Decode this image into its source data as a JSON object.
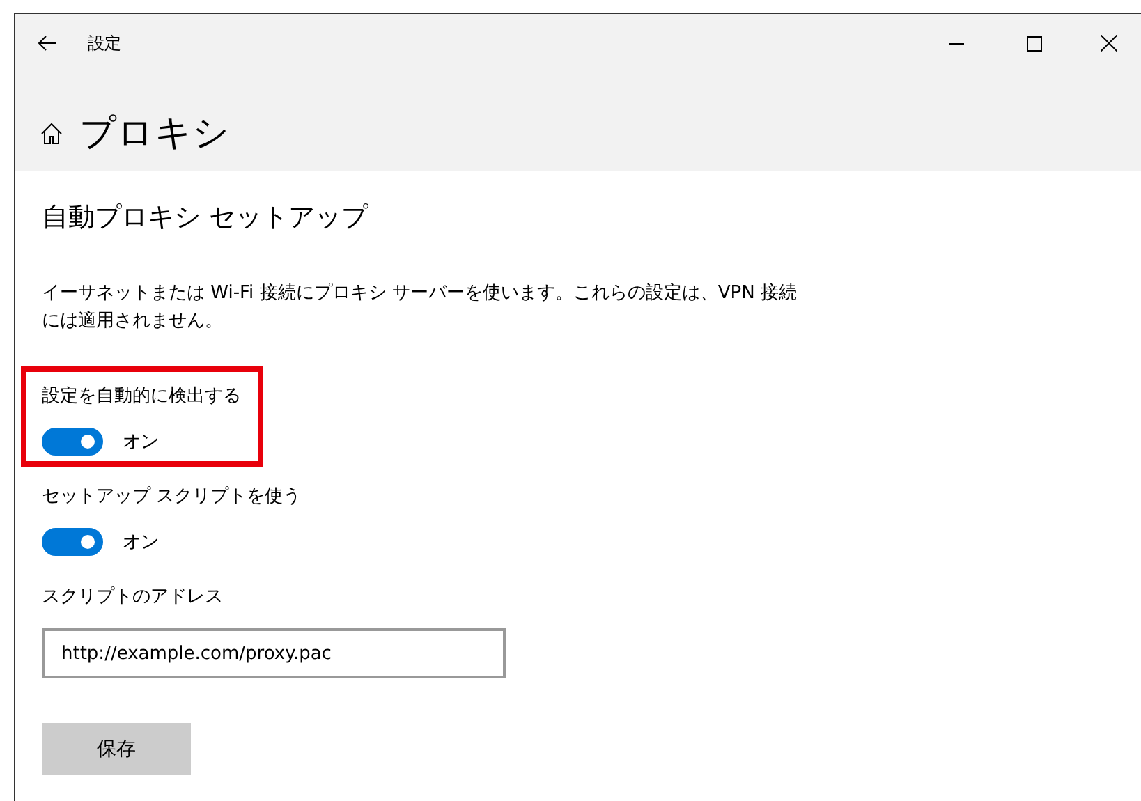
{
  "window": {
    "title": "設定"
  },
  "page": {
    "title": "プロキシ"
  },
  "section": {
    "title": "自動プロキシ セットアップ",
    "description": "イーサネットまたは Wi-Fi 接続にプロキシ サーバーを使います。これらの設定は、VPN 接続には適用されません。"
  },
  "settings": [
    {
      "kind": "toggle",
      "label": "設定を自動的に検出する",
      "on": true,
      "state_label": "オン",
      "highlighted": true
    },
    {
      "kind": "toggle",
      "label": "セットアップ スクリプトを使う",
      "on": true,
      "state_label": "オン",
      "highlighted": false
    },
    {
      "kind": "text",
      "label": "スクリプトのアドレス",
      "value": "http://example.com/proxy.pac",
      "highlighted": false
    }
  ],
  "save_button": {
    "label": "保存"
  }
}
